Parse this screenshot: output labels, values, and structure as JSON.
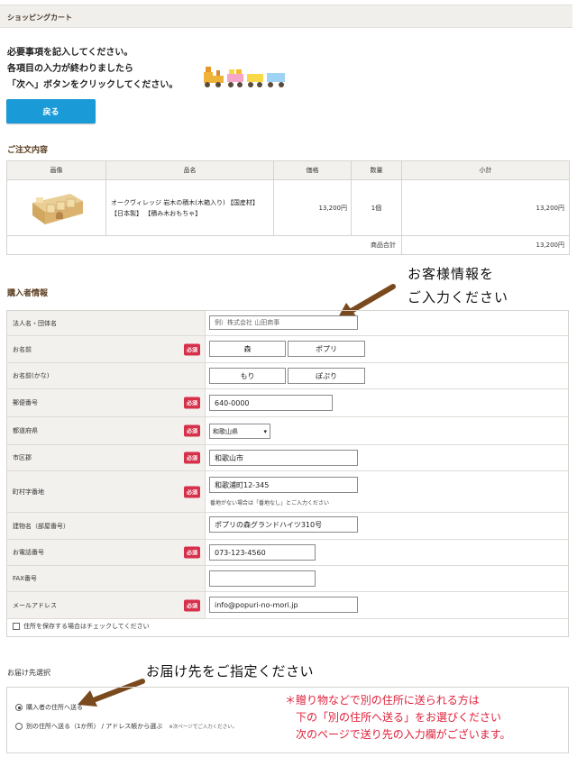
{
  "header": {
    "title": "ショッピングカート"
  },
  "intro": {
    "line1": "必要事項を記入してください。",
    "line2": "各項目の入力が終わりましたら",
    "line3": "「次へ」ボタンをクリックしてください。"
  },
  "back_button": "戻る",
  "order": {
    "section_title": "ご注文内容",
    "columns": [
      "画像",
      "品名",
      "価格",
      "数量",
      "小計"
    ],
    "items": [
      {
        "name_line1": "オークヴィレッジ 岩木の積木(木箱入り) 【国産材】",
        "name_line2": "【日本製】 【積み木おもちゃ】",
        "price": "13,200円",
        "qty": "1個",
        "subtotal": "13,200円"
      }
    ],
    "total_label": "商品合計",
    "total_value": "13,200円"
  },
  "buyer": {
    "section_title": "購入者情報",
    "required_badge": "必須",
    "fields": {
      "company": {
        "label": "法人名・団体名",
        "placeholder": "例）株式会社 山田商事"
      },
      "name": {
        "label": "お名前",
        "last": "森",
        "first": "ポプリ"
      },
      "kana": {
        "label": "お名前(かな)",
        "last": "もり",
        "first": "ぽぷり"
      },
      "zip": {
        "label": "郵便番号",
        "value": "640-0000"
      },
      "pref": {
        "label": "都道府県",
        "value": "和歌山県"
      },
      "city": {
        "label": "市区郡",
        "value": "和歌山市"
      },
      "town": {
        "label": "町村字番地",
        "value": "和歌浦町12-345",
        "note": "番地がない場合は「番地なし」とご入力ください"
      },
      "building": {
        "label": "建物名（部屋番号）",
        "value": "ポプリの森グランドハイツ310号"
      },
      "tel": {
        "label": "お電話番号",
        "value": "073-123-4560"
      },
      "fax": {
        "label": "FAX番号",
        "value": ""
      },
      "email": {
        "label": "メールアドレス",
        "value": "info@popuri-no-mori.jp"
      }
    },
    "save_address_label": "住所を保存する場合はチェックしてください"
  },
  "annotations": {
    "buyer_line1": "お客様情報を",
    "buyer_line2": "ご入力ください",
    "delivery": "お届け先をご指定ください",
    "gift_line1": "＊贈り物などで別の住所に送られる方は",
    "gift_line2": "下の「別の住所へ送る」をお選びください",
    "gift_line3": "次のページで送り先の入力欄がございます。"
  },
  "delivery": {
    "section_title": "お届け先選択",
    "option1": "購入者の住所へ送る",
    "option2": "別の住所へ送る（1か所） / アドレス帳から選ぶ",
    "option2_note": "※次ページでご入力ください。"
  },
  "colors": {
    "accent_blue": "#1a9ad6",
    "required_red": "#d6304a",
    "annotation_red": "#e0203a",
    "arrow_brown": "#7a4a1e"
  }
}
